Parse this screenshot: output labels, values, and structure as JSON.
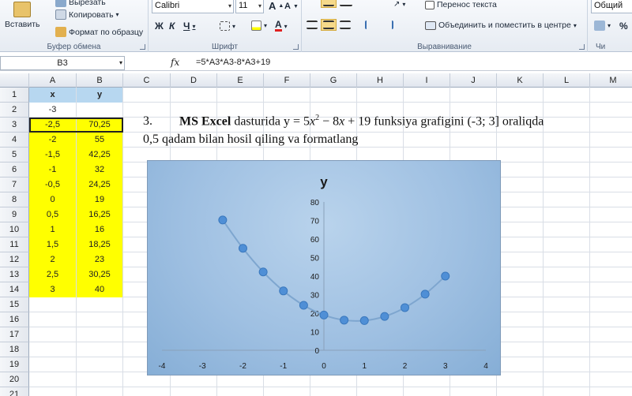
{
  "ribbon": {
    "clipboard": {
      "paste_label": "Вставить",
      "cut_label": "Вырезать",
      "copy_label": "Копировать",
      "format_painter_label": "Формат по образцу",
      "group_label": "Буфер обмена"
    },
    "font": {
      "font_name": "Calibri",
      "font_size": "11",
      "bold": "Ж",
      "italic": "К",
      "underline": "Ч",
      "group_label": "Шрифт"
    },
    "alignment": {
      "wrap_text_label": "Перенос текста",
      "merge_label": "Объединить и поместить в центре",
      "group_label": "Выравнивание"
    },
    "number": {
      "format": "Общий",
      "percent": "%",
      "group_label": "Чи"
    }
  },
  "formula_bar": {
    "name_box": "B3",
    "fx": "fx",
    "formula": "=5*A3*A3-8*A3+19"
  },
  "columns": [
    "A",
    "B",
    "C",
    "D",
    "E",
    "F",
    "G",
    "H",
    "I",
    "J",
    "K",
    "L",
    "M"
  ],
  "rows": [
    "1",
    "2",
    "3",
    "4",
    "5",
    "6",
    "7",
    "8",
    "9",
    "10",
    "11",
    "12",
    "13",
    "14",
    "15",
    "16",
    "17",
    "18",
    "19",
    "20",
    "21"
  ],
  "table": {
    "header_x": "x",
    "header_y": "y",
    "a2": "-3",
    "data": [
      {
        "x": "-2,5",
        "y": "70,25"
      },
      {
        "x": "-2",
        "y": "55"
      },
      {
        "x": "-1,5",
        "y": "42,25"
      },
      {
        "x": "-1",
        "y": "32"
      },
      {
        "x": "-0,5",
        "y": "24,25"
      },
      {
        "x": "0",
        "y": "19"
      },
      {
        "x": "0,5",
        "y": "16,25"
      },
      {
        "x": "1",
        "y": "16"
      },
      {
        "x": "1,5",
        "y": "18,25"
      },
      {
        "x": "2",
        "y": "23"
      },
      {
        "x": "2,5",
        "y": "30,25"
      },
      {
        "x": "3",
        "y": "40"
      }
    ]
  },
  "task": {
    "number": "3.",
    "bold_part": "MS Excel",
    "text_a": " dasturida y = 5",
    "text_b": " − 8",
    "text_c": " + 19 funksiya grafigini (-3; 3] oraliqda",
    "line2": "0,5 qadam bilan hosil qiling va formatlang",
    "var_x": "x",
    "sup2": "2"
  },
  "chart_data": {
    "type": "scatter",
    "title": "y",
    "x": [
      -2.5,
      -2,
      -1.5,
      -1,
      -0.5,
      0,
      0.5,
      1,
      1.5,
      2,
      2.5,
      3
    ],
    "y": [
      70.25,
      55,
      42.25,
      32,
      24.25,
      19,
      16.25,
      16,
      18.25,
      23,
      30.25,
      40
    ],
    "xlim": [
      -4,
      4
    ],
    "ylim": [
      0,
      80
    ],
    "xticks": [
      "-4",
      "-3",
      "-2",
      "-1",
      "0",
      "1",
      "2",
      "3",
      "4"
    ],
    "yticks": [
      "0",
      "10",
      "20",
      "30",
      "40",
      "50",
      "60",
      "70",
      "80"
    ],
    "smooth_line": true,
    "grid": false,
    "colors": {
      "line": "#7ea6cf",
      "marker": "#4f8fd6",
      "bg": "#a9c7e6"
    }
  },
  "colors": {
    "highlight": "#ffff00",
    "header_fill": "#b7d7f0"
  }
}
